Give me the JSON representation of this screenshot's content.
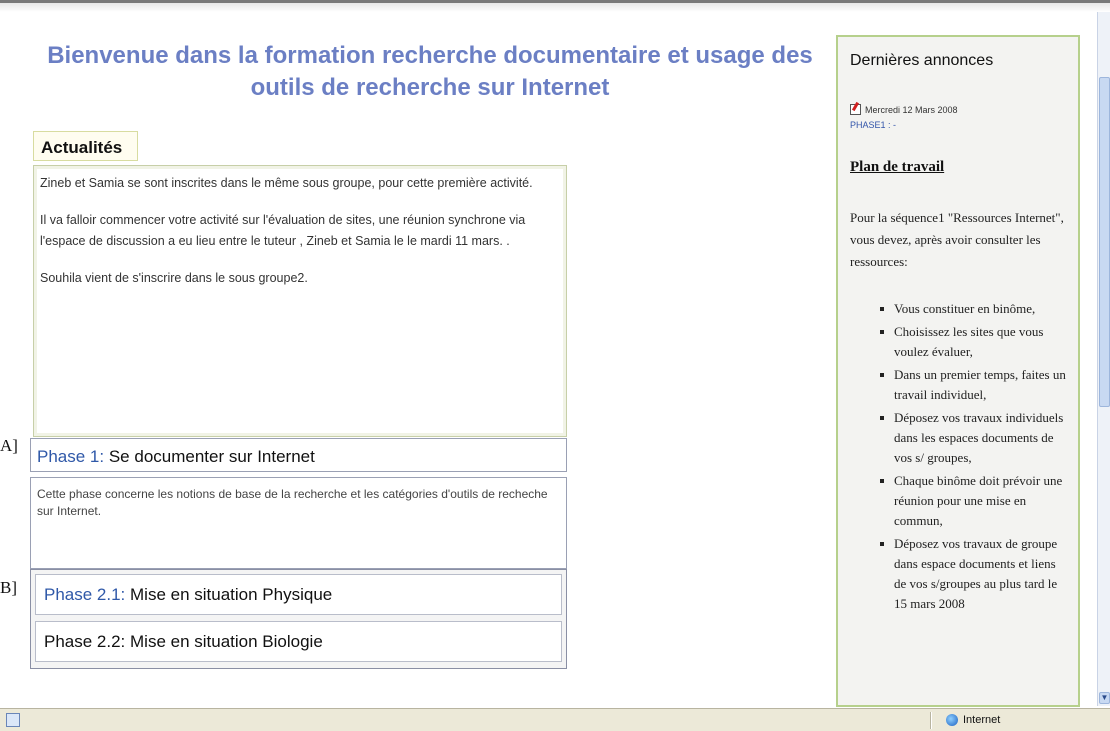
{
  "page": {
    "title": "Bienvenue dans la formation recherche documentaire et usage des outils de recherche sur Internet"
  },
  "news": {
    "tab_label": "Actualités",
    "paragraphs": [
      "Zineb et Samia se sont inscrites dans le même sous groupe, pour cette première activité.",
      "Il va falloir commencer votre activité sur l'évaluation de sites, une réunion synchrone via l'espace de discussion a eu lieu entre le tuteur , Zineb et Samia le le mardi 11 mars. .",
      "Souhila vient de s'inscrire dans le sous groupe2."
    ]
  },
  "phase1": {
    "number": "Phase 1:",
    "title": "Se documenter sur Internet",
    "description": "Cette phase concerne les notions de base de la recherche et les catégories d'outils de recheche sur Internet."
  },
  "phase2": {
    "items": [
      {
        "number": "Phase 2.1:",
        "title": "Mise en situation Physique"
      },
      {
        "number": "Phase 2.2:",
        "title": "Mise en situation  Biologie"
      }
    ]
  },
  "side_labels": {
    "a": "A]",
    "b": "B]"
  },
  "sidebar": {
    "title": "Dernières annonces",
    "announcement_date": "Mercredi 12 Mars 2008",
    "announcement_link": "PHASE1 : -",
    "plan_title": "Plan de travail",
    "plan_intro": "Pour la séquence1 \"Ressources Internet\", vous devez, après avoir consulter les ressources:",
    "plan_items": [
      "Vous constituer en binôme,",
      "Choisissez les sites que vous voulez évaluer,",
      "Dans un premier temps, faites un travail individuel,",
      "Déposez vos travaux individuels dans les espaces documents de vos s/ groupes,",
      "Chaque binôme doit prévoir une réunion pour une mise en commun,",
      "Déposez vos travaux de groupe dans espace documents et liens de vos s/groupes au plus tard le 15 mars 2008"
    ]
  },
  "statusbar": {
    "zone_label": "Internet",
    "scroll_down_glyph": "▼"
  },
  "colors": {
    "title": "#6b7fc4",
    "phase_number": "#2f58a8",
    "sidebar_border": "#b6d08c",
    "statusbar_bg": "#ece9d8"
  }
}
